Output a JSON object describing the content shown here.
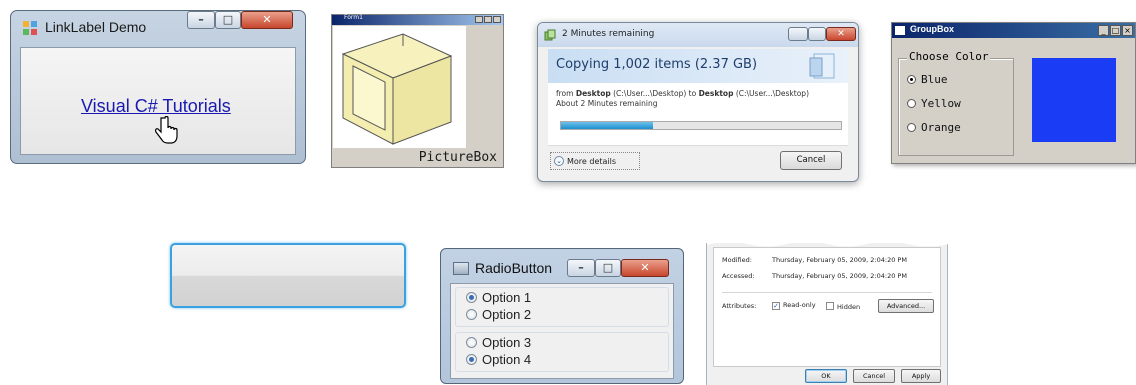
{
  "linklabel_window": {
    "title": "LinkLabel Demo",
    "link_text": "Visual C# Tutorials",
    "icons": [
      "app-icon",
      "minimize-icon",
      "maximize-icon",
      "close-icon",
      "hand-cursor-icon"
    ]
  },
  "picturebox_window": {
    "caption": "Form1",
    "label": "PictureBox",
    "image": "3d-box-drawing"
  },
  "copy_dialog": {
    "title": "2 Minutes remaining",
    "heading": "Copying 1,002 items (2.37 GB)",
    "from_prefix": "from ",
    "from_bold": "Desktop",
    "from_path": " (C:\\User...\\Desktop)",
    "to_prefix": " to ",
    "to_bold": "Desktop",
    "to_path": " (C:\\User...\\Desktop)",
    "remaining": "About 2 Minutes remaining",
    "progress": 0.33,
    "more_details": "More details",
    "cancel": "Cancel"
  },
  "groupbox_window": {
    "title": "GroupBox",
    "group_label": "Choose Color",
    "options": [
      {
        "label": "Blue",
        "checked": true
      },
      {
        "label": "Yellow",
        "checked": false
      },
      {
        "label": "Orange",
        "checked": false
      }
    ],
    "swatch_color": "#1a3cf5"
  },
  "radiobutton_window": {
    "title": "RadioButton",
    "group1": [
      {
        "label": "Option 1",
        "checked": true
      },
      {
        "label": "Option 2",
        "checked": false
      }
    ],
    "group2": [
      {
        "label": "Option 3",
        "checked": false
      },
      {
        "label": "Option 4",
        "checked": true
      }
    ]
  },
  "properties_dialog": {
    "modified_label": "Modified:",
    "modified_value": "Thursday, February 05, 2009, 2:04:20 PM",
    "accessed_label": "Accessed:",
    "accessed_value": "Thursday, February 05, 2009, 2:04:20 PM",
    "attributes_label": "Attributes:",
    "readonly_label": "Read-only",
    "readonly_checked": true,
    "hidden_label": "Hidden",
    "hidden_checked": false,
    "advanced": "Advanced...",
    "ok": "OK",
    "cancel": "Cancel",
    "apply": "Apply"
  },
  "colors": {
    "link": "#1a1ab0",
    "win7_title": "#c2d2e4",
    "classic_title": "#0a246a",
    "progress": "#1b8fcf",
    "button_focus": "#3aa0e0"
  }
}
